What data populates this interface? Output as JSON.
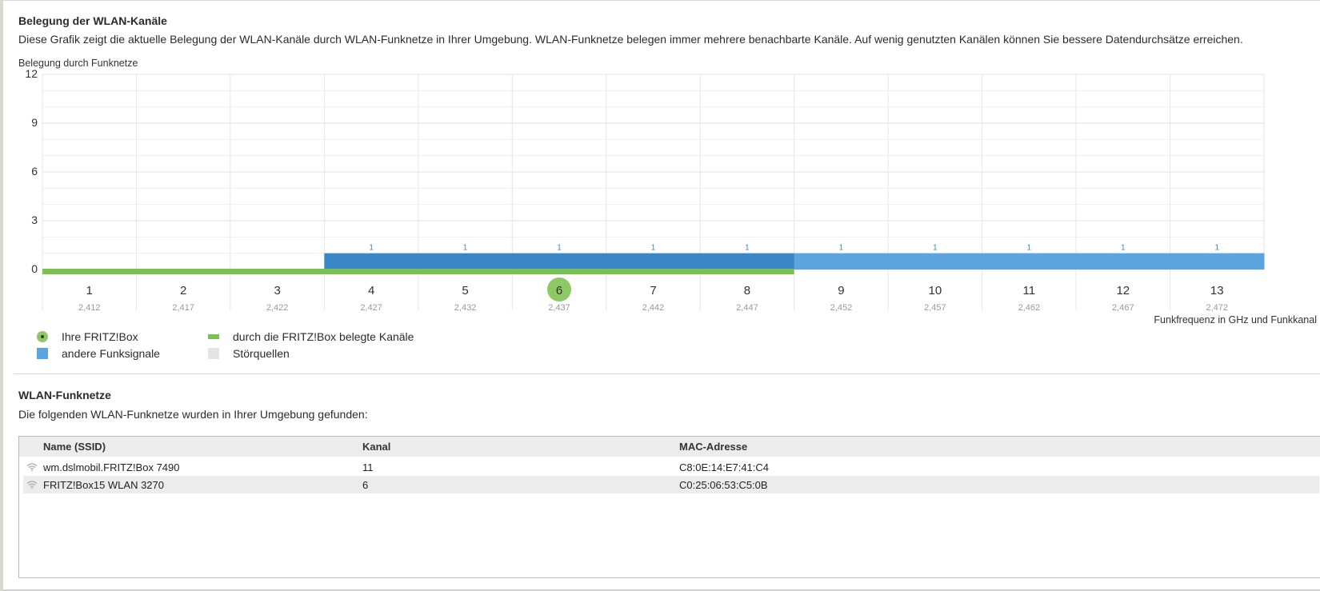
{
  "section1": {
    "title": "Belegung der WLAN-Kanäle",
    "description": "Diese Grafik zeigt die aktuelle Belegung der WLAN-Kanäle durch WLAN-Funknetze in Ihrer Umgebung. WLAN-Funknetze belegen immer mehrere benachbarte Kanäle. Auf wenig genutzten Kanälen können Sie bessere Datendurchsätze erreichen."
  },
  "chart_data": {
    "type": "bar",
    "ylabel": "Belegung durch Funknetze",
    "xlabel": "Funkfrequenz in GHz und Funkkanal",
    "ylim": [
      0,
      12
    ],
    "yticks": [
      "12",
      "9",
      "6",
      "3",
      "0"
    ],
    "categories": [
      "1",
      "2",
      "3",
      "4",
      "5",
      "6",
      "7",
      "8",
      "9",
      "10",
      "11",
      "12",
      "13"
    ],
    "frequencies": [
      "2,412",
      "2,417",
      "2,422",
      "2,427",
      "2,432",
      "2,437",
      "2,442",
      "2,447",
      "2,452",
      "2,457",
      "2,462",
      "2,467",
      "2,472"
    ],
    "series": [
      {
        "name": "andere Funksignale",
        "values": [
          0,
          0,
          0,
          1,
          1,
          1,
          1,
          1,
          1,
          1,
          1,
          1,
          1
        ],
        "labels": [
          "",
          "",
          "",
          "1",
          "1",
          "1",
          "1",
          "1",
          "1",
          "1",
          "1",
          "1",
          "1"
        ],
        "colors": [
          "#3a87c8",
          "#3a87c8",
          "#3a87c8",
          "#3a87c8",
          "#3a87c8",
          "#3a87c8",
          "#3a87c8",
          "#3a87c8",
          "#5aa5e0",
          "#5aa5e0",
          "#5aa5e0",
          "#5aa5e0",
          "#5aa5e0"
        ]
      }
    ],
    "fritzbox_used_channels": [
      "1",
      "2",
      "3",
      "4",
      "5",
      "6",
      "7",
      "8"
    ],
    "own_channel": "6",
    "grid": true,
    "colors": {
      "own": "#8cc864",
      "used": "#79c150",
      "other_dark": "#3a87c8",
      "other_light": "#5aa5e0",
      "noise": "#e4e4e4"
    }
  },
  "legend": {
    "own_fritzbox": "Ihre FRITZ!Box",
    "used_channels": "durch die FRITZ!Box belegte Kanäle",
    "other_signals": "andere Funksignale",
    "noise_sources": "Störquellen"
  },
  "section2": {
    "title": "WLAN-Funknetze",
    "description": "Die folgenden WLAN-Funknetze wurden in Ihrer Umgebung gefunden:"
  },
  "networks": {
    "headers": {
      "name": "Name (SSID)",
      "channel": "Kanal",
      "mac": "MAC-Adresse"
    },
    "rows": [
      {
        "name": "wm.dslmobil.FRITZ!Box 7490",
        "channel": "11",
        "mac": "C8:0E:14:E7:41:C4",
        "icon": "wifi-icon"
      },
      {
        "name": "FRITZ!Box15 WLAN 3270",
        "channel": "6",
        "mac": "C0:25:06:53:C5:0B",
        "icon": "wifi-icon"
      }
    ]
  }
}
